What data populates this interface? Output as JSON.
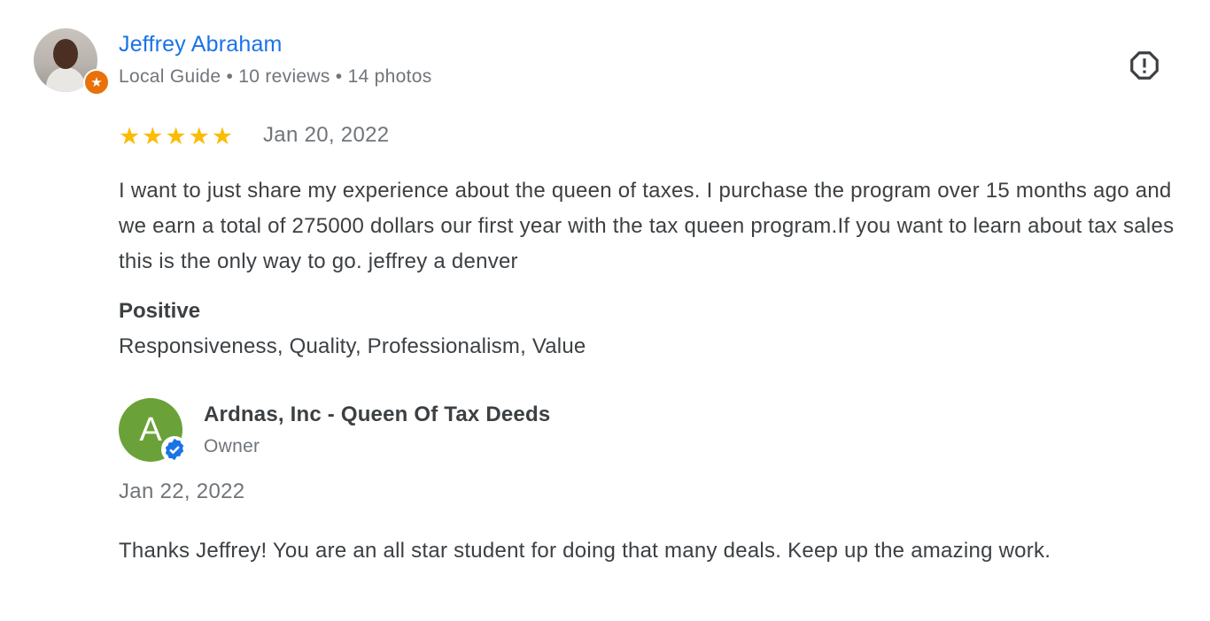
{
  "reviewer": {
    "name": "Jeffrey Abraham",
    "meta": "Local Guide • 10 reviews • 14 photos",
    "avatar_icon": "person-photo",
    "badge_icon": "local-guide-star-icon"
  },
  "report": {
    "icon": "report-icon"
  },
  "rating": {
    "stars": 5,
    "star_glyph": "★",
    "date": "Jan 20, 2022"
  },
  "review_text": "I want to just share my experience about the queen of taxes. I purchase the program over 15 months ago and we earn a total of 275000 dollars our first year with the tax queen program.If you want to learn about tax sales this is the only way to go. jeffrey a denver",
  "positive": {
    "title": "Positive",
    "values": "Responsiveness, Quality, Professionalism, Value"
  },
  "owner_reply": {
    "avatar_letter": "A",
    "name": "Ardnas, Inc - Queen Of Tax Deeds",
    "role": "Owner",
    "date": "Jan 22, 2022",
    "text": "Thanks Jeffrey! You are an all star student for doing that many deals. Keep up the amazing work."
  },
  "colors": {
    "link_blue": "#1a73e8",
    "star_yellow": "#fbbc04",
    "guide_orange": "#e8710a",
    "owner_green": "#6aa139",
    "verified_blue": "#1a73e8",
    "secondary_text": "#70757a"
  }
}
